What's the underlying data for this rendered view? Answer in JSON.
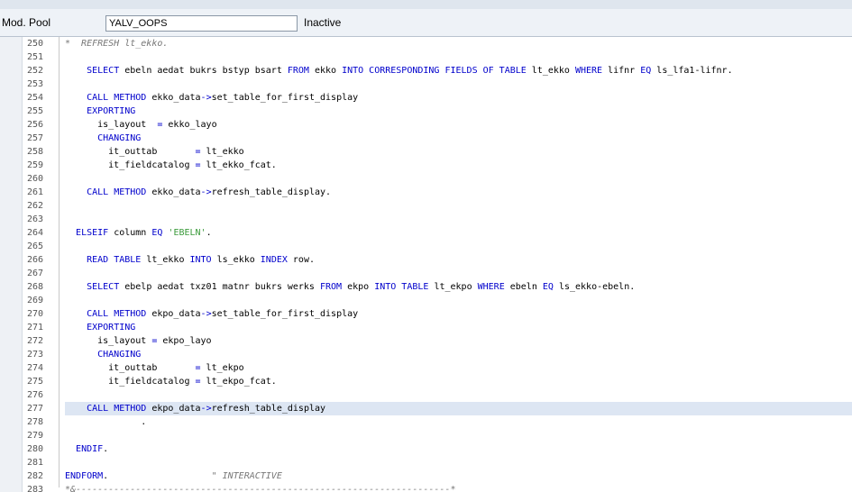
{
  "header": {
    "label": "Mod. Pool",
    "program": "YALV_OOPS",
    "status": "Inactive"
  },
  "lines": [
    {
      "n": "250",
      "code": [
        {
          "t": "*  REFRESH lt_ekko.",
          "c": "cm"
        }
      ]
    },
    {
      "n": "251",
      "code": []
    },
    {
      "n": "252",
      "code": [
        {
          "t": "    ",
          "c": ""
        },
        {
          "t": "SELECT",
          "c": "kw"
        },
        {
          "t": " ebeln aedat bukrs bstyp bsart ",
          "c": ""
        },
        {
          "t": "FROM",
          "c": "kw"
        },
        {
          "t": " ekko ",
          "c": ""
        },
        {
          "t": "INTO CORRESPONDING FIELDS OF TABLE",
          "c": "kw"
        },
        {
          "t": " lt_ekko ",
          "c": ""
        },
        {
          "t": "WHERE",
          "c": "kw"
        },
        {
          "t": " lifnr ",
          "c": ""
        },
        {
          "t": "EQ",
          "c": "kw"
        },
        {
          "t": " ls_lfa1-lifnr.",
          "c": ""
        }
      ]
    },
    {
      "n": "253",
      "code": []
    },
    {
      "n": "254",
      "code": [
        {
          "t": "    ",
          "c": ""
        },
        {
          "t": "CALL METHOD",
          "c": "kw"
        },
        {
          "t": " ekko_data",
          "c": ""
        },
        {
          "t": "->",
          "c": "op"
        },
        {
          "t": "set_table_for_first_display",
          "c": ""
        }
      ]
    },
    {
      "n": "255",
      "code": [
        {
          "t": "    ",
          "c": ""
        },
        {
          "t": "EXPORTING",
          "c": "kw"
        }
      ]
    },
    {
      "n": "256",
      "code": [
        {
          "t": "      is_layout  ",
          "c": ""
        },
        {
          "t": "=",
          "c": "op"
        },
        {
          "t": " ekko_layo",
          "c": ""
        }
      ]
    },
    {
      "n": "257",
      "code": [
        {
          "t": "      ",
          "c": ""
        },
        {
          "t": "CHANGING",
          "c": "kw"
        }
      ]
    },
    {
      "n": "258",
      "code": [
        {
          "t": "        it_outtab       ",
          "c": ""
        },
        {
          "t": "=",
          "c": "op"
        },
        {
          "t": " lt_ekko",
          "c": ""
        }
      ]
    },
    {
      "n": "259",
      "code": [
        {
          "t": "        it_fieldcatalog ",
          "c": ""
        },
        {
          "t": "=",
          "c": "op"
        },
        {
          "t": " lt_ekko_fcat.",
          "c": ""
        }
      ]
    },
    {
      "n": "260",
      "code": []
    },
    {
      "n": "261",
      "code": [
        {
          "t": "    ",
          "c": ""
        },
        {
          "t": "CALL METHOD",
          "c": "kw"
        },
        {
          "t": " ekko_data",
          "c": ""
        },
        {
          "t": "->",
          "c": "op"
        },
        {
          "t": "refresh_table_display.",
          "c": ""
        }
      ]
    },
    {
      "n": "262",
      "code": []
    },
    {
      "n": "263",
      "code": []
    },
    {
      "n": "264",
      "code": [
        {
          "t": "  ",
          "c": ""
        },
        {
          "t": "ELSEIF",
          "c": "kw"
        },
        {
          "t": " column ",
          "c": ""
        },
        {
          "t": "EQ",
          "c": "kw"
        },
        {
          "t": " ",
          "c": ""
        },
        {
          "t": "'EBELN'",
          "c": "st"
        },
        {
          "t": ".",
          "c": ""
        }
      ]
    },
    {
      "n": "265",
      "code": []
    },
    {
      "n": "266",
      "code": [
        {
          "t": "    ",
          "c": ""
        },
        {
          "t": "READ TABLE",
          "c": "kw"
        },
        {
          "t": " lt_ekko ",
          "c": ""
        },
        {
          "t": "INTO",
          "c": "kw"
        },
        {
          "t": " ls_ekko ",
          "c": ""
        },
        {
          "t": "INDEX",
          "c": "kw"
        },
        {
          "t": " row.",
          "c": ""
        }
      ]
    },
    {
      "n": "267",
      "code": []
    },
    {
      "n": "268",
      "code": [
        {
          "t": "    ",
          "c": ""
        },
        {
          "t": "SELECT",
          "c": "kw"
        },
        {
          "t": " ebelp aedat txz01 matnr bukrs werks ",
          "c": ""
        },
        {
          "t": "FROM",
          "c": "kw"
        },
        {
          "t": " ekpo ",
          "c": ""
        },
        {
          "t": "INTO TABLE",
          "c": "kw"
        },
        {
          "t": " lt_ekpo ",
          "c": ""
        },
        {
          "t": "WHERE",
          "c": "kw"
        },
        {
          "t": " ebeln ",
          "c": ""
        },
        {
          "t": "EQ",
          "c": "kw"
        },
        {
          "t": " ls_ekko-ebeln.",
          "c": ""
        }
      ]
    },
    {
      "n": "269",
      "code": []
    },
    {
      "n": "270",
      "code": [
        {
          "t": "    ",
          "c": ""
        },
        {
          "t": "CALL METHOD",
          "c": "kw"
        },
        {
          "t": " ekpo_data",
          "c": ""
        },
        {
          "t": "->",
          "c": "op"
        },
        {
          "t": "set_table_for_first_display",
          "c": ""
        }
      ]
    },
    {
      "n": "271",
      "code": [
        {
          "t": "    ",
          "c": ""
        },
        {
          "t": "EXPORTING",
          "c": "kw"
        }
      ]
    },
    {
      "n": "272",
      "code": [
        {
          "t": "      is_layout ",
          "c": ""
        },
        {
          "t": "=",
          "c": "op"
        },
        {
          "t": " ekpo_layo",
          "c": ""
        }
      ]
    },
    {
      "n": "273",
      "code": [
        {
          "t": "      ",
          "c": ""
        },
        {
          "t": "CHANGING",
          "c": "kw"
        }
      ]
    },
    {
      "n": "274",
      "code": [
        {
          "t": "        it_outtab       ",
          "c": ""
        },
        {
          "t": "=",
          "c": "op"
        },
        {
          "t": " lt_ekpo",
          "c": ""
        }
      ]
    },
    {
      "n": "275",
      "code": [
        {
          "t": "        it_fieldcatalog ",
          "c": ""
        },
        {
          "t": "=",
          "c": "op"
        },
        {
          "t": " lt_ekpo_fcat.",
          "c": ""
        }
      ]
    },
    {
      "n": "276",
      "code": []
    },
    {
      "n": "277",
      "code": [
        {
          "t": "    ",
          "c": ""
        },
        {
          "t": "CALL METHOD",
          "c": "kw"
        },
        {
          "t": " ekpo_data",
          "c": ""
        },
        {
          "t": "->",
          "c": "op"
        },
        {
          "t": "refresh_table_display",
          "c": ""
        }
      ],
      "highlight": true
    },
    {
      "n": "278",
      "code": [
        {
          "t": "              .",
          "c": ""
        }
      ]
    },
    {
      "n": "279",
      "code": []
    },
    {
      "n": "280",
      "code": [
        {
          "t": "  ",
          "c": ""
        },
        {
          "t": "ENDIF",
          "c": "kw"
        },
        {
          "t": ".",
          "c": ""
        }
      ]
    },
    {
      "n": "281",
      "code": []
    },
    {
      "n": "282",
      "code": [
        {
          "t": "ENDFORM",
          "c": "kw"
        },
        {
          "t": ".                   ",
          "c": ""
        },
        {
          "t": "\" INTERACTIVE",
          "c": "cm"
        }
      ]
    },
    {
      "n": "283",
      "code": [
        {
          "t": "*&---------------------------------------------------------------------*",
          "c": "cm"
        }
      ]
    }
  ]
}
